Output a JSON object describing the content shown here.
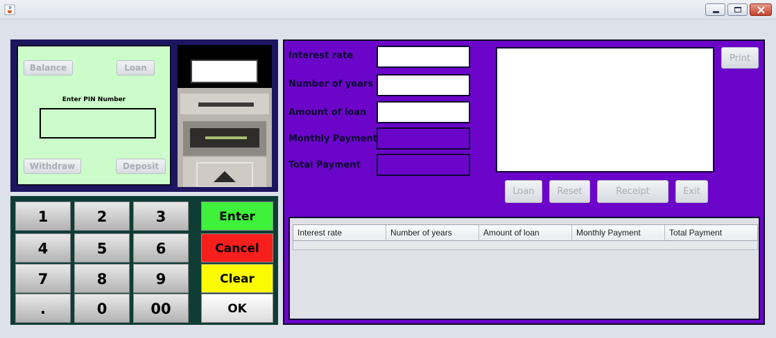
{
  "window": {
    "app_icon": "java-cup-icon",
    "controls": [
      "minimize-icon",
      "maximize-icon",
      "close-icon"
    ]
  },
  "pin_panel": {
    "balance_label": "Balance",
    "loan_label": "Loan",
    "pin_prompt": "Enter PIN Number",
    "pin_value": "",
    "withdraw_label": "Withdraw",
    "deposit_label": "Deposit",
    "background_color": "#cbfcc9"
  },
  "keypad": {
    "keys": [
      "1",
      "2",
      "3",
      "4",
      "5",
      "6",
      "7",
      "8",
      "9",
      ".",
      "0",
      "00"
    ],
    "enter_label": "Enter",
    "cancel_label": "Cancel",
    "clear_label": "Clear",
    "ok_label": "OK",
    "colors": {
      "enter": "#3ff13a",
      "cancel": "#f71f1c",
      "clear": "#fbfb00",
      "ok": "#eeeeee"
    }
  },
  "loan_form": {
    "interest_rate_label": "Interest rate",
    "interest_rate_value": "",
    "years_label": "Number of years",
    "years_value": "",
    "amount_label": "Amount of loan",
    "amount_value": "",
    "monthly_label": "Monthly Payment",
    "monthly_value": "",
    "total_label": "Total Payment",
    "total_value": "",
    "receipt_text": "",
    "background_color": "#6b05c9"
  },
  "actions": {
    "print_label": "Print",
    "loan_label": "Loan",
    "reset_label": "Reset",
    "receipt_label": "Receipt",
    "exit_label": "Exit"
  },
  "table": {
    "columns": [
      "Interest rate",
      "Number of years",
      "Amount of loan",
      "Monthly Payment",
      "Total Payment"
    ],
    "rows": []
  }
}
